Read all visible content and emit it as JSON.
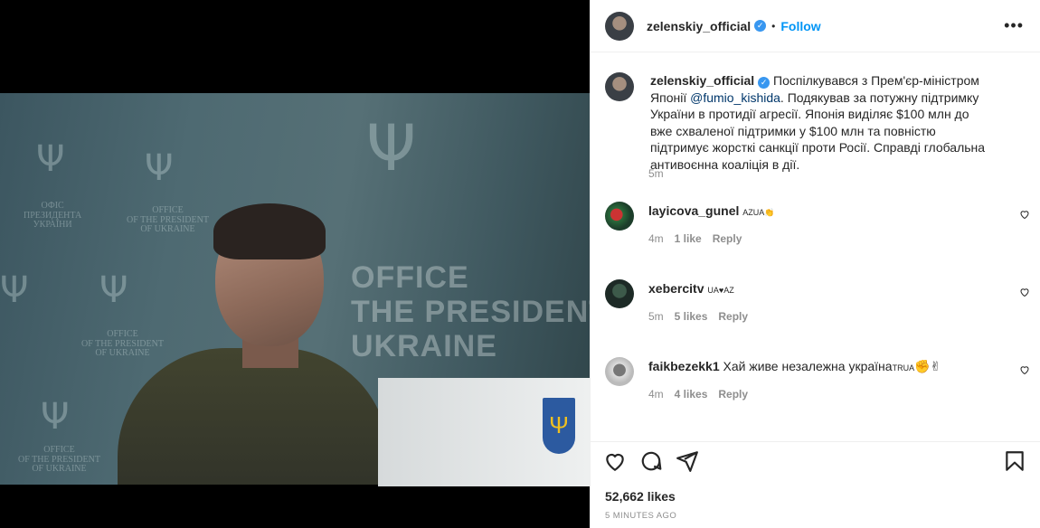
{
  "post": {
    "author": "zelenskiy_official",
    "follow_label": "Follow",
    "dot": "•",
    "more_label": "•••",
    "caption_user": "zelenskiy_official",
    "caption_lines": [
      " Поспілкувався з Прем'єр-міністром Японії",
      "@fumio_kishida",
      ". Подякував за потужну підтримку України в протидії агресії. Японія виділяє $100 млн до вже схваленої підтримки у $100 млн та повністю підтримує жорсткі санкції проти Росії. Справді глобальна антивоєнна коаліція в дії."
    ],
    "caption_time": "5m",
    "likes": "52,662 likes",
    "time_ago": "5 MINUTES AGO"
  },
  "photo_text": {
    "office_ua": "ОФІС\nПРЕЗИДЕНТА\nУКРАЇНИ",
    "office_en": "OFFICE\nOF THE PRESIDENT\nOF UKRAINE",
    "big_office": "OFFICE\nTHE PRESIDENT\nUKRAINE"
  },
  "comments": [
    {
      "user": "layicova_gunel",
      "text": "AZUA👏",
      "time": "4m",
      "likes": "1 like",
      "reply": "Reply"
    },
    {
      "user": "xebercitv",
      "text": "UA♥AZ",
      "time": "5m",
      "likes": "5 likes",
      "reply": "Reply"
    },
    {
      "user": "faikbezekk1",
      "text": "Хай живе незалежна україна",
      "flag": "TRUA",
      "emoji": "✊✌",
      "time": "4m",
      "likes": "4 likes",
      "reply": "Reply"
    }
  ],
  "colors": {
    "accent": "#0095f6",
    "verified": "#3897f0",
    "muted": "#8e8e8e"
  },
  "icons": [
    "heart-icon",
    "comment-icon",
    "share-icon",
    "bookmark-icon",
    "more-icon",
    "verified-icon"
  ]
}
